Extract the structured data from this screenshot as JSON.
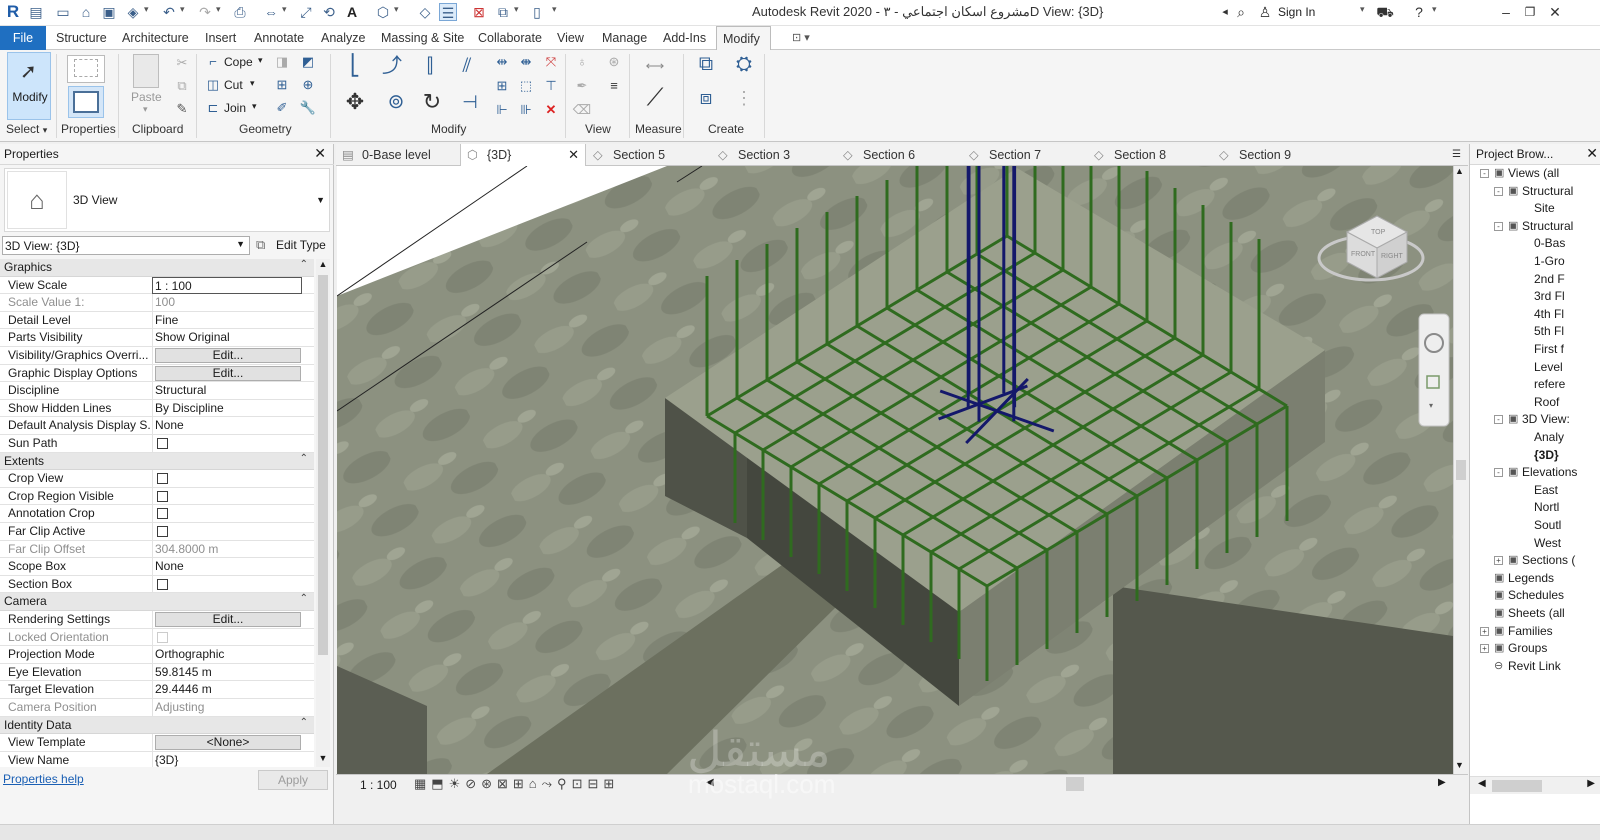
{
  "window": {
    "title": "Autodesk Revit 2020 - مشروع اسكان اجتماعي - ٣D View: {3D}",
    "sign_in": "Sign In",
    "app_logo": "R"
  },
  "menu": {
    "tabs": [
      "File",
      "Structure",
      "Architecture",
      "Insert",
      "Annotate",
      "Analyze",
      "Massing & Site",
      "Collaborate",
      "View",
      "Manage",
      "Add-Ins",
      "Modify"
    ],
    "active": "Modify"
  },
  "ribbon": {
    "select_panel": {
      "button": "Modify",
      "label": "Select"
    },
    "properties_panel": {
      "label": "Properties"
    },
    "clipboard_panel": {
      "paste": "Paste",
      "label": "Clipboard"
    },
    "geometry_panel": {
      "cope": "Cope",
      "cut": "Cut",
      "join": "Join",
      "label": "Geometry"
    },
    "modify_panel": {
      "label": "Modify"
    },
    "view_panel": {
      "label": "View"
    },
    "measure_panel": {
      "label": "Measure"
    },
    "create_panel": {
      "label": "Create"
    }
  },
  "properties": {
    "title": "Properties",
    "type_name": "3D View",
    "selector": "3D View: {3D}",
    "edit_type": "Edit Type",
    "groups": {
      "graphics": "Graphics",
      "extents": "Extents",
      "camera": "Camera",
      "identity": "Identity Data"
    },
    "rows": {
      "view_scale": {
        "name": "View Scale",
        "value": "1 : 100"
      },
      "scale_value": {
        "name": "Scale Value    1:",
        "value": "100"
      },
      "detail_level": {
        "name": "Detail Level",
        "value": "Fine"
      },
      "parts_visibility": {
        "name": "Parts Visibility",
        "value": "Show Original"
      },
      "vg_overrides": {
        "name": "Visibility/Graphics Overri...",
        "value": "Edit..."
      },
      "graphic_display": {
        "name": "Graphic Display Options",
        "value": "Edit..."
      },
      "discipline": {
        "name": "Discipline",
        "value": "Structural"
      },
      "hidden_lines": {
        "name": "Show Hidden Lines",
        "value": "By Discipline"
      },
      "analysis_display": {
        "name": "Default Analysis Display S...",
        "value": "None"
      },
      "sun_path": {
        "name": "Sun Path"
      },
      "crop_view": {
        "name": "Crop View"
      },
      "crop_region_visible": {
        "name": "Crop Region Visible"
      },
      "annotation_crop": {
        "name": "Annotation Crop"
      },
      "far_clip_active": {
        "name": "Far Clip Active"
      },
      "far_clip_offset": {
        "name": "Far Clip Offset",
        "value": "304.8000 m"
      },
      "scope_box": {
        "name": "Scope Box",
        "value": "None"
      },
      "section_box": {
        "name": "Section Box"
      },
      "rendering_settings": {
        "name": "Rendering Settings",
        "value": "Edit..."
      },
      "locked_orientation": {
        "name": "Locked Orientation"
      },
      "projection_mode": {
        "name": "Projection Mode",
        "value": "Orthographic"
      },
      "eye_elevation": {
        "name": "Eye Elevation",
        "value": "59.8145 m"
      },
      "target_elevation": {
        "name": "Target Elevation",
        "value": "29.4446 m"
      },
      "camera_position": {
        "name": "Camera Position",
        "value": "Adjusting"
      },
      "view_template": {
        "name": "View Template",
        "value": "<None>"
      },
      "view_name": {
        "name": "View Name",
        "value": "{3D}"
      }
    },
    "help_link": "Properties help",
    "apply": "Apply"
  },
  "view_tabs": [
    "0-Base level",
    "{3D}",
    "Section 5",
    "Section 3",
    "Section 6",
    "Section 7",
    "Section 8",
    "Section 9"
  ],
  "active_view_tab": "{3D}",
  "viewcube": {
    "top": "TOP",
    "front": "FRONT",
    "right": "RIGHT"
  },
  "status": {
    "scale": "1 : 100"
  },
  "watermark": {
    "arabic": "مستقل",
    "latin": "mostaql.com"
  },
  "project_browser": {
    "title": "Project Brow...",
    "items": [
      {
        "label": "Views (all",
        "indent": 0,
        "exp": "-",
        "bold": false
      },
      {
        "label": "Structural",
        "indent": 1,
        "exp": "-",
        "bold": false
      },
      {
        "label": "Site",
        "indent": 3,
        "exp": "",
        "bold": false
      },
      {
        "label": "Structural",
        "indent": 1,
        "exp": "-",
        "bold": false
      },
      {
        "label": "0-Bas",
        "indent": 3,
        "exp": "",
        "bold": false
      },
      {
        "label": "1-Gro",
        "indent": 3,
        "exp": "",
        "bold": false
      },
      {
        "label": "2nd F",
        "indent": 3,
        "exp": "",
        "bold": false
      },
      {
        "label": "3rd Fl",
        "indent": 3,
        "exp": "",
        "bold": false
      },
      {
        "label": "4th Fl",
        "indent": 3,
        "exp": "",
        "bold": false
      },
      {
        "label": "5th Fl",
        "indent": 3,
        "exp": "",
        "bold": false
      },
      {
        "label": "First f",
        "indent": 3,
        "exp": "",
        "bold": false
      },
      {
        "label": "Level",
        "indent": 3,
        "exp": "",
        "bold": false
      },
      {
        "label": "refere",
        "indent": 3,
        "exp": "",
        "bold": false
      },
      {
        "label": "Roof",
        "indent": 3,
        "exp": "",
        "bold": false
      },
      {
        "label": "3D View:",
        "indent": 1,
        "exp": "-",
        "bold": false
      },
      {
        "label": "Analy",
        "indent": 3,
        "exp": "",
        "bold": false
      },
      {
        "label": "{3D}",
        "indent": 3,
        "exp": "",
        "bold": true
      },
      {
        "label": "Elevations",
        "indent": 1,
        "exp": "-",
        "bold": false
      },
      {
        "label": "East",
        "indent": 3,
        "exp": "",
        "bold": false
      },
      {
        "label": "Nortl",
        "indent": 3,
        "exp": "",
        "bold": false
      },
      {
        "label": "Soutl",
        "indent": 3,
        "exp": "",
        "bold": false
      },
      {
        "label": "West",
        "indent": 3,
        "exp": "",
        "bold": false
      },
      {
        "label": "Sections (",
        "indent": 1,
        "exp": "+",
        "bold": false
      },
      {
        "label": "Legends",
        "indent": 0,
        "exp": "",
        "bold": false
      },
      {
        "label": "Schedules",
        "indent": 0,
        "exp": "",
        "bold": false
      },
      {
        "label": "Sheets (all",
        "indent": 0,
        "exp": "",
        "bold": false
      },
      {
        "label": "Families",
        "indent": 0,
        "exp": "+",
        "bold": false
      },
      {
        "label": "Groups",
        "indent": 0,
        "exp": "+",
        "bold": false
      },
      {
        "label": "Revit Link",
        "indent": 0,
        "exp": "",
        "bold": false
      }
    ]
  }
}
